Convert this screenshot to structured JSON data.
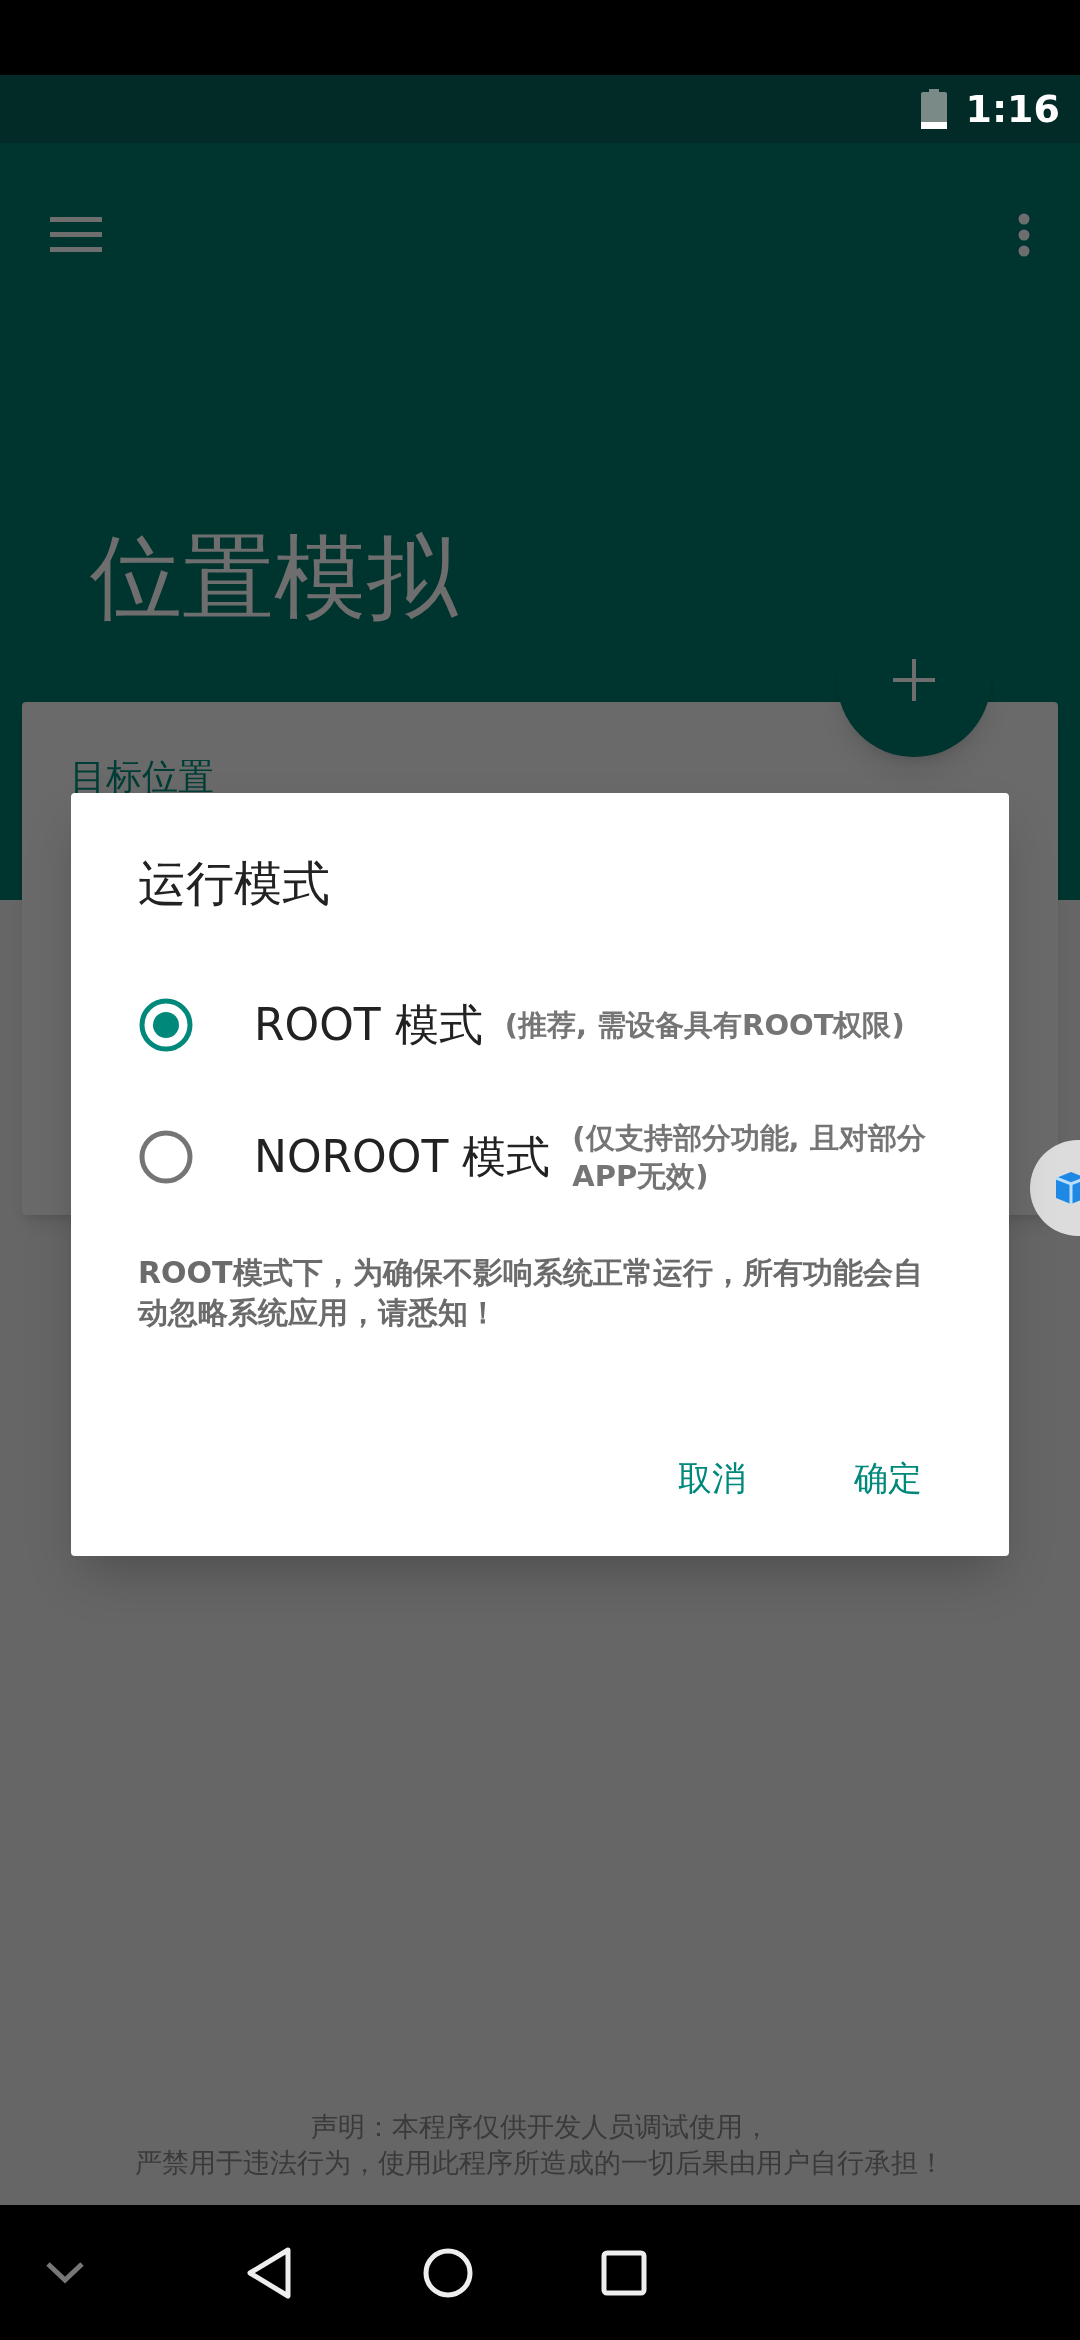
{
  "status_bar": {
    "time": "1:16"
  },
  "toolbar": {
    "title": "位置模拟"
  },
  "card": {
    "title": "目标位置"
  },
  "dialog": {
    "title": "运行模式",
    "options": [
      {
        "label": "ROOT 模式",
        "note": "(推荐, 需设备具有ROOT权限)",
        "selected": true
      },
      {
        "label": "NOROOT 模式",
        "note": "(仅支持部分功能, 且对部分APP无效)",
        "selected": false
      }
    ],
    "message": "ROOT模式下，为确保不影响系统正常运行，所有功能会自动忽略系统应用，请悉知！",
    "buttons": [
      "取消",
      "确定"
    ]
  },
  "disclaimer": [
    "声明：本程序仅供开发人员调试使用，",
    "严禁用于违法行为，使用此程序所造成的一切后果由用户自行承担！"
  ]
}
